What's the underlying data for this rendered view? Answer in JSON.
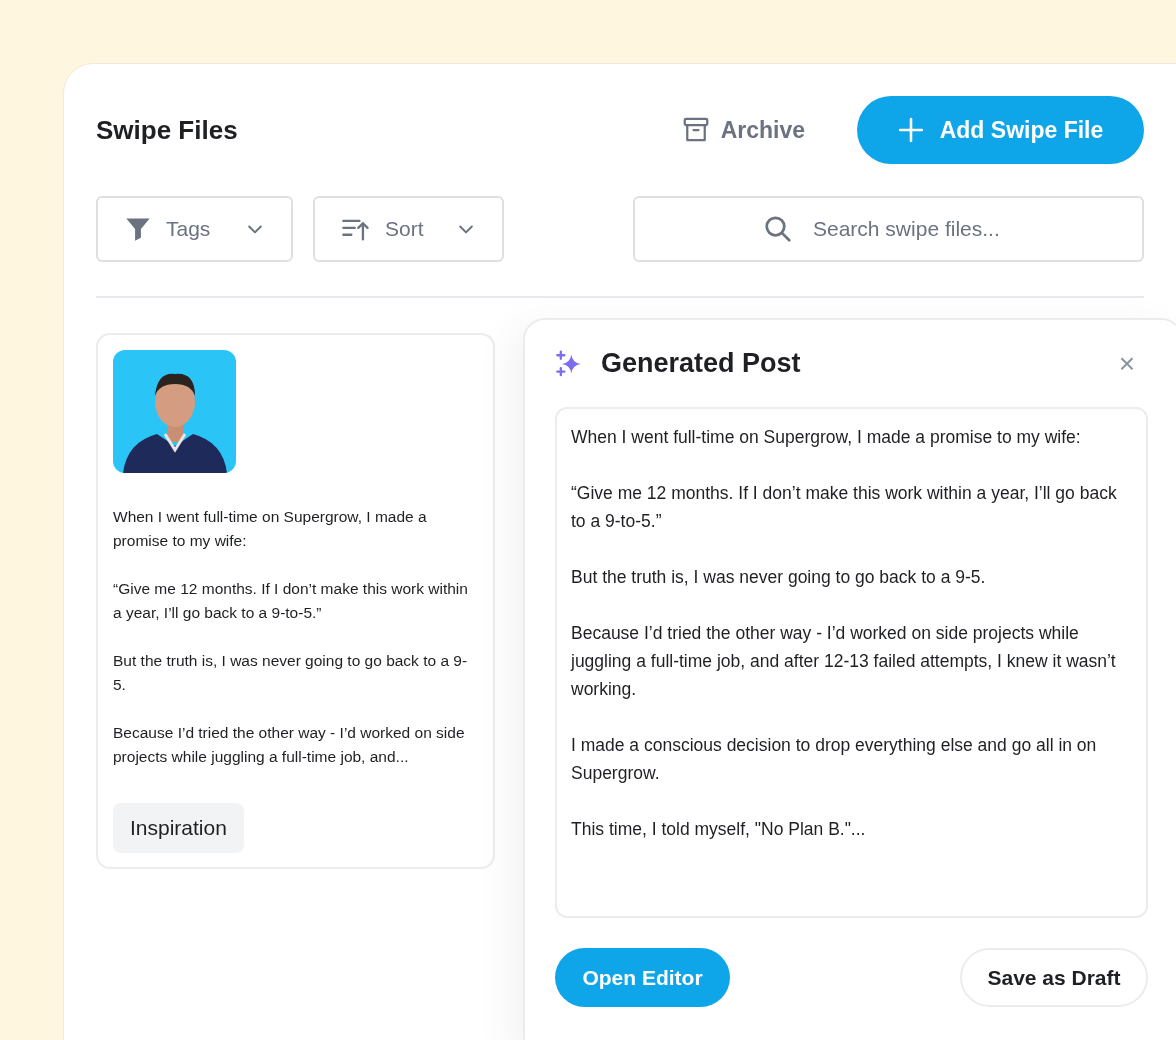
{
  "header": {
    "title": "Swipe Files",
    "archive": "Archive",
    "add_button": "Add Swipe File"
  },
  "filters": {
    "tags": "Tags",
    "sort": "Sort",
    "search": {
      "placeholder": "Search swipe files..."
    }
  },
  "card": {
    "kind": "picture",
    "paragraphs": [
      "When I went full-time on Supergrow, I made a promise to my wife:",
      "“Give me 12 months. If I don’t make this work within a year, I’ll go back to a 9-to-5.”",
      "But the truth is, I was never going to go back to a 9-5.",
      "Because I’d tried the other way - I’d worked on side projects while juggling a full-time job, and..."
    ],
    "tag": "Inspiration"
  },
  "generated_post": {
    "title": "Generated Post",
    "close": "×",
    "paragraphs": [
      "When I went full-time on Supergrow, I made a promise to my wife:",
      "“Give me 12 months. If I don’t make this work within a year, I’ll go back to a 9-to-5.”",
      "But the truth is, I was never going to go back to a 9-5.",
      "Because I’d tried the other way - I’d worked on side projects while juggling a full-time job, and after 12-13 failed attempts, I knew it wasn’t working.",
      "I made a conscious decision to drop everything else and go all in on Supergrow.",
      "This time, I told myself, \"No Plan B.\"..."
    ],
    "open_button": "Open Editor",
    "draft_button": "Save as Draft"
  }
}
